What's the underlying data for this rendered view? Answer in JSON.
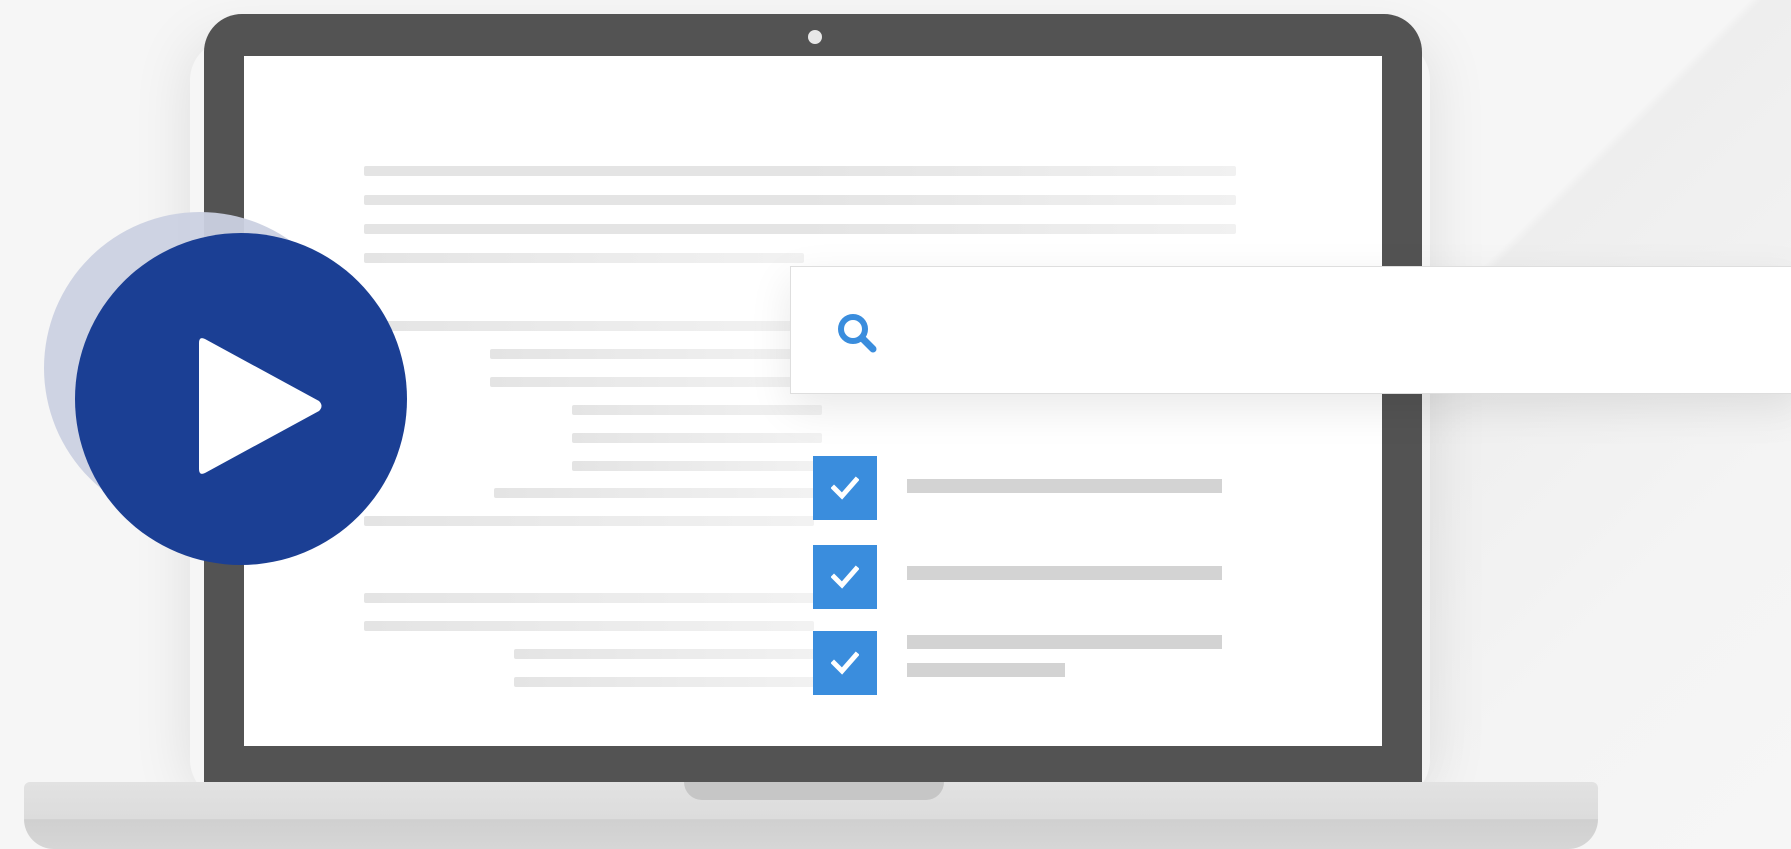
{
  "illustration": {
    "play_button": {
      "icon": "play-icon",
      "color": "#1b3f94",
      "halo_color": "#cbd1e1"
    },
    "search": {
      "icon": "search-icon",
      "value": "",
      "accent": "#3a8ddd"
    },
    "checklist": {
      "icon": "checkmark-icon",
      "checked_count": 3,
      "box_color": "#3a8ddd"
    },
    "laptop": {
      "frame_color": "#535353",
      "screen_color": "#ffffff"
    }
  }
}
